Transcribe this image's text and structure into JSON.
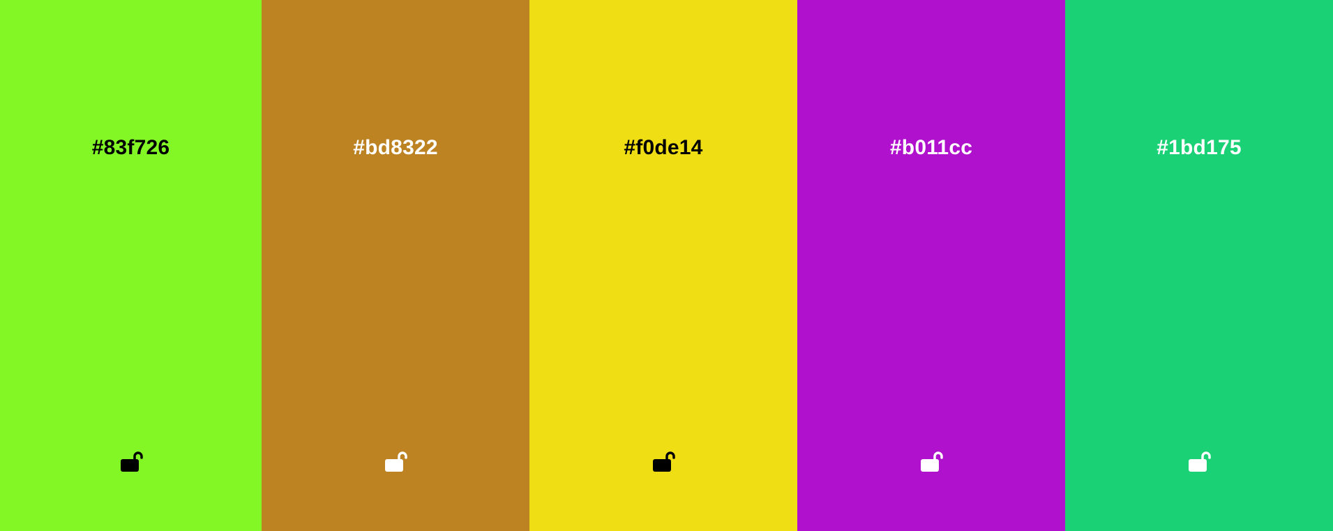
{
  "palette": {
    "swatches": [
      {
        "hex": "#83f726",
        "color": "#83f726",
        "text_color": "#000000",
        "lock_state": "unlocked",
        "lock_icon": "unlock-icon"
      },
      {
        "hex": "#bd8322",
        "color": "#bd8322",
        "text_color": "#ffffff",
        "lock_state": "unlocked",
        "lock_icon": "unlock-icon"
      },
      {
        "hex": "#f0de14",
        "color": "#f0de14",
        "text_color": "#000000",
        "lock_state": "unlocked",
        "lock_icon": "unlock-icon"
      },
      {
        "hex": "#b011cc",
        "color": "#b011cc",
        "text_color": "#ffffff",
        "lock_state": "unlocked",
        "lock_icon": "unlock-icon"
      },
      {
        "hex": "#1bd175",
        "color": "#1bd175",
        "text_color": "#ffffff",
        "lock_state": "unlocked",
        "lock_icon": "unlock-icon"
      }
    ]
  }
}
